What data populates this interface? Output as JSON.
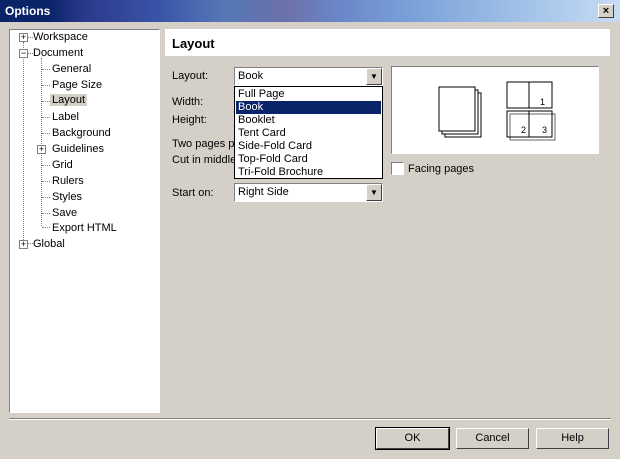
{
  "window": {
    "title": "Options",
    "close_label": "×"
  },
  "tree": {
    "workspace": "Workspace",
    "document": "Document",
    "children": [
      "General",
      "Page Size",
      "Layout",
      "Label",
      "Background",
      "Guidelines",
      "Grid",
      "Rulers",
      "Styles",
      "Save",
      "Export HTML"
    ],
    "global": "Global",
    "selected": "Layout"
  },
  "panel": {
    "title": "Layout",
    "layout_label": "Layout:",
    "layout_value": "Book",
    "width_label": "Width:",
    "height_label": "Height:",
    "two_pages_label": "Two pages p",
    "cut_middle_label": "Cut in middle",
    "start_on_label": "Start on:",
    "start_on_value": "Right Side",
    "facing_pages_label": "Facing pages",
    "dropdown_options": [
      "Full Page",
      "Book",
      "Booklet",
      "Tent Card",
      "Side-Fold Card",
      "Top-Fold Card",
      "Tri-Fold Brochure"
    ],
    "dropdown_selected": "Book",
    "preview_pages": [
      "1",
      "2",
      "3"
    ]
  },
  "buttons": {
    "ok": "OK",
    "cancel": "Cancel",
    "help": "Help"
  },
  "colors": {
    "title_bar": "#0a246a",
    "selection": "#0a246a",
    "face": "#d4d0c8"
  }
}
